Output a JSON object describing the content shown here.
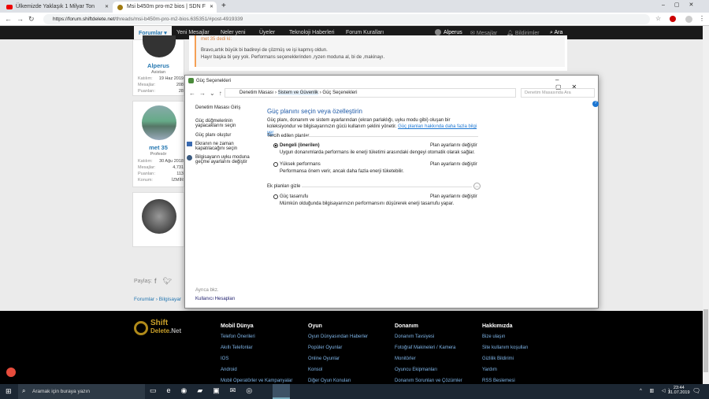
{
  "browser": {
    "tabs": [
      {
        "title": "Ülkemizde Yaklaşık 1 Milyar Ton"
      },
      {
        "title": "Msi b450m pro-m2 bios | SDN F"
      }
    ],
    "url_host": "https://forum.shiftdelete.net",
    "url_path": "/threads/msi-b450m-pro-m2-bios.635351/#post-4919339"
  },
  "nav": {
    "items": [
      "Forumlar",
      "Yeni Mesajlar",
      "Neler yeni",
      "Üyeler",
      "Teknoloji Haberleri",
      "Forum Kuralları"
    ],
    "user": "Alperus",
    "messages": "Mesajlar",
    "alerts": "Bildirimler",
    "search": "Ara"
  },
  "users": [
    {
      "name": "Alperus",
      "role": "Asistan",
      "stats": [
        [
          "Katılım:",
          "19 Haz 2019"
        ],
        [
          "Mesajlar:",
          "208"
        ],
        [
          "Puanları:",
          "28"
        ]
      ]
    },
    {
      "name": "met 35",
      "role": "Profesör",
      "stats": [
        [
          "Katılım:",
          "30 Ağu 2018"
        ],
        [
          "Mesajlar:",
          "4,731"
        ],
        [
          "Puanları:",
          "113"
        ],
        [
          "Konum:",
          "İZMİR"
        ]
      ]
    }
  ],
  "post": {
    "quote_author": "met 35 dedi ki:",
    "line1": "Bravo,artık büyük bi badireyi de çözmüş ve işi kapmış oldun.",
    "line2": "Hayır başka bi şey yok. Performans seçeneklerinden ,ryzen moduna al, bi de ,makinayı."
  },
  "share": {
    "label": "Paylaş:"
  },
  "breadcrumb": [
    "Forumlar",
    "Bilgisayar"
  ],
  "dialog": {
    "title": "Güç Seçenekleri",
    "path": [
      "Denetim Masası",
      "Sistem ve Güvenlik",
      "Güç Seçenekleri"
    ],
    "search_placeholder": "Denetim Masasında Ara",
    "left": [
      "Denetim Masası Giriş",
      "Güç düğmelerinin yapacaklarını seçin",
      "Güç planı oluştur",
      "Ekranın ne zaman kapatılacağını seçin",
      "Bilgisayarın uyku moduna geçme ayarlarını değiştir"
    ],
    "see_also": "Ayrıca bkz.",
    "user_accounts": "Kullanıcı Hesapları",
    "heading": "Güç planını seçin veya özelleştirin",
    "desc": "Güç planı, donanım ve sistem ayarlarından (ekran parlaklığı, uyku modu gibi) oluşan bir koleksiyondur ve bilgisayarınızın gücü kullanım şeklini yönetir.",
    "desc_link": "Güç planları hakkında daha fazla bilgi ver",
    "preferred": "Tercih edilen planlar",
    "extra": "Ek planları gizle",
    "change": "Plan ayarlarını değiştir",
    "plans": [
      {
        "name": "Dengeli (önerilen)",
        "desc": "Uygun donanımlarda performans ile enerji tüketimi arasındaki dengeyi otomatik olarak sağlar.",
        "selected": true
      },
      {
        "name": "Yüksek performans",
        "desc": "Performansa önem verir, ancak daha fazla enerji tüketebilir.",
        "selected": false
      },
      {
        "name": "Güç tasarrufu",
        "desc": "Mümkün olduğunda bilgisayarınızın performansını düşürerek enerji tasarrufu yapar.",
        "selected": false
      }
    ]
  },
  "footer": {
    "logo": "ShiftDelete.Net",
    "cols": [
      {
        "title": "Mobil Dünya",
        "links": [
          "Telefon Önerileri",
          "Akıllı Telefonlar",
          "IOS",
          "Android",
          "Mobil Operatörler ve Kampanyalar"
        ]
      },
      {
        "title": "Oyun",
        "links": [
          "Oyun Dünyasından Haberler",
          "Popüler Oyunlar",
          "Online Oyunlar",
          "Konsol",
          "Diğer Oyun Konuları"
        ]
      },
      {
        "title": "Donanım",
        "links": [
          "Donanım Tavsiyesi",
          "Fotoğraf Makineleri / Kamera",
          "Monitörler",
          "Oyuncu Ekipmanları",
          "Donanım Sorunları ve Çözümler"
        ]
      },
      {
        "title": "Hakkımızda",
        "links": [
          "Bize ulaşın",
          "Site kullanım koşulları",
          "Gizlilik Bildirimi",
          "Yardım",
          "RSS Beslemesi"
        ]
      }
    ]
  },
  "taskbar": {
    "search": "Aramak için buraya yazın",
    "time": "23:44",
    "date": "31.07.2019"
  }
}
